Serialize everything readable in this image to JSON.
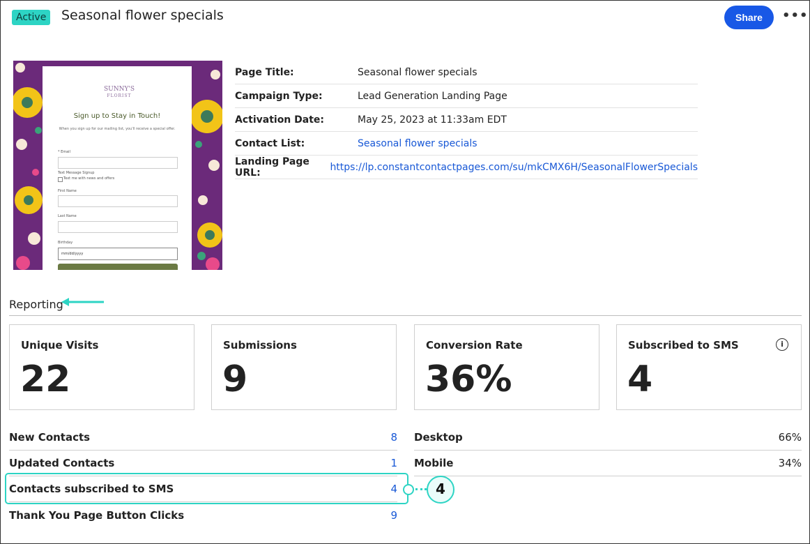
{
  "header": {
    "status_badge": "Active",
    "title": "Seasonal flower specials",
    "share_label": "Share",
    "more_label": "•••"
  },
  "preview": {
    "logo_line1": "SUNNY'S",
    "logo_line2": "FLORIST",
    "heading": "Sign up to Stay in Touch!",
    "subtext": "When you sign up for our mailing list, you'll receive a special offer.",
    "fields": {
      "email": "* Email",
      "sms_signup": "Text Message Signup",
      "sms_checkbox": "Text me with news and offers",
      "first_name": "First Name",
      "last_name": "Last Name",
      "birthday": "Birthday",
      "birthday_placeholder": "mm/dd/yyyy"
    },
    "colors": {
      "background": "#6b2a7a",
      "button": "#6b7a44"
    }
  },
  "details": [
    {
      "label": "Page Title:",
      "value": "Seasonal flower specials",
      "link": false
    },
    {
      "label": "Campaign Type:",
      "value": "Lead Generation Landing Page",
      "link": false
    },
    {
      "label": "Activation Date:",
      "value": "May 25, 2023 at 11:33am EDT",
      "link": false
    },
    {
      "label": "Contact List:",
      "value": "Seasonal flower specials",
      "link": true
    },
    {
      "label": "Landing Page URL:",
      "value": "https://lp.constantcontactpages.com/su/mkCMX6H/SeasonalFlowerSpecials",
      "link": true
    }
  ],
  "reporting": {
    "heading": "Reporting",
    "cards": [
      {
        "title": "Unique Visits",
        "value": "22"
      },
      {
        "title": "Submissions",
        "value": "9"
      },
      {
        "title": "Conversion Rate",
        "value": "36%"
      },
      {
        "title": "Subscribed to SMS",
        "value": "4",
        "info_icon": "ⓘ"
      }
    ],
    "contact_stats": [
      {
        "label": "New Contacts",
        "value": "8"
      },
      {
        "label": "Updated Contacts",
        "value": "1"
      },
      {
        "label": "Contacts subscribed to SMS",
        "value": "4"
      },
      {
        "label": "Thank You Page Button Clicks",
        "value": "9"
      }
    ],
    "device_stats": [
      {
        "label": "Desktop",
        "value": "66%"
      },
      {
        "label": "Mobile",
        "value": "34%"
      }
    ]
  },
  "annotation": {
    "callout_number": "4",
    "color": "#2dd4c4"
  },
  "colors": {
    "primary_blue": "#1858e6",
    "accent_teal": "#2dd4c4"
  }
}
